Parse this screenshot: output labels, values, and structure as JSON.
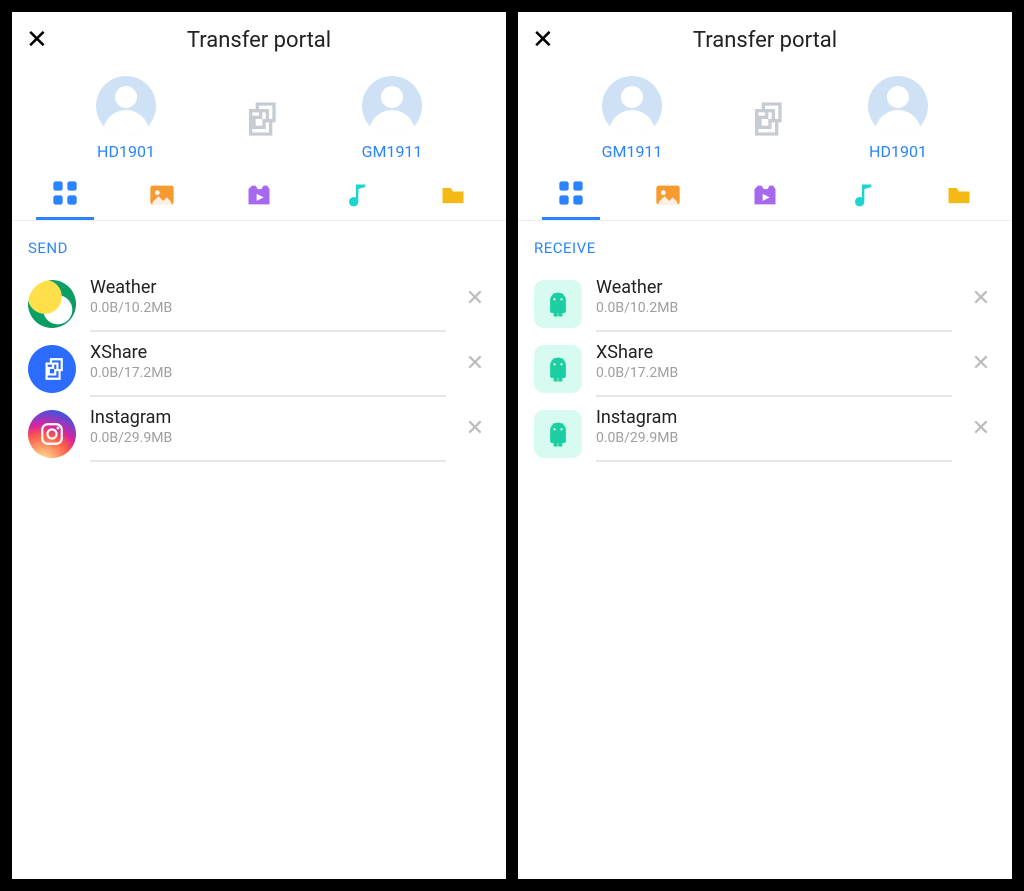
{
  "left": {
    "title": "Transfer portal",
    "peerA": "HD1901",
    "peerB": "GM1911",
    "section": "SEND",
    "items": [
      {
        "name": "Weather",
        "size": "0.0B/10.2MB"
      },
      {
        "name": "XShare",
        "size": "0.0B/17.2MB"
      },
      {
        "name": "Instagram",
        "size": "0.0B/29.9MB"
      }
    ]
  },
  "right": {
    "title": "Transfer portal",
    "peerA": "GM1911",
    "peerB": "HD1901",
    "section": "RECEIVE",
    "items": [
      {
        "name": "Weather",
        "size": "0.0B/10.2MB"
      },
      {
        "name": "XShare",
        "size": "0.0B/17.2MB"
      },
      {
        "name": "Instagram",
        "size": "0.0B/29.9MB"
      }
    ]
  },
  "tabs": [
    "apps",
    "photos",
    "videos",
    "music",
    "files"
  ],
  "activeTab": "apps"
}
